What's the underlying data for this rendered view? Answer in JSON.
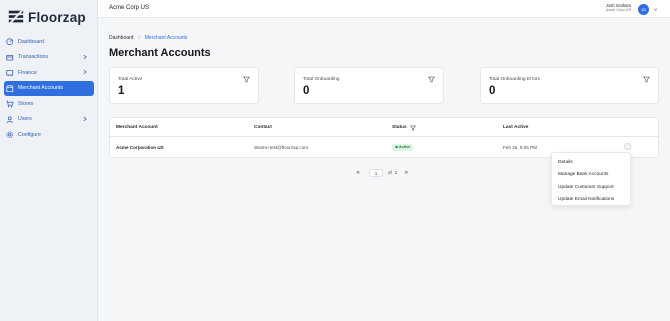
{
  "app": {
    "name": "Floorzap"
  },
  "sidebar": {
    "items": [
      {
        "label": "Dashboard",
        "icon": "dashboard-icon",
        "has_chevron": false,
        "active": false
      },
      {
        "label": "Transactions",
        "icon": "transactions-icon",
        "has_chevron": true,
        "active": false
      },
      {
        "label": "Finance",
        "icon": "finance-icon",
        "has_chevron": true,
        "active": false
      },
      {
        "label": "Merchant Accounts",
        "icon": "merchant-icon",
        "has_chevron": false,
        "active": true
      },
      {
        "label": "Stores",
        "icon": "cart-icon",
        "has_chevron": false,
        "active": false
      },
      {
        "label": "Users",
        "icon": "user-icon",
        "has_chevron": true,
        "active": false
      },
      {
        "label": "Configure",
        "icon": "gear-icon",
        "has_chevron": false,
        "active": false
      }
    ]
  },
  "header": {
    "org_title": "Acme Corp US",
    "user_name": "Josh Graham",
    "user_org": "Acme Corp US",
    "avatar_initials": "JG"
  },
  "breadcrumb": {
    "home": "Dashboard",
    "separator": "/",
    "current": "Merchant Accounts"
  },
  "page": {
    "title": "Merchant Accounts"
  },
  "stats": [
    {
      "label": "Total Active",
      "value": "1"
    },
    {
      "label": "Total Onboarding",
      "value": "0"
    },
    {
      "label": "Total Onboarding Errors",
      "value": "0"
    }
  ],
  "table": {
    "columns": [
      "Merchant Account",
      "Contact",
      "Status",
      "Last Active"
    ],
    "rows": [
      {
        "merchant": "Acme Corporation US",
        "contact": "deatra+test@floorzap.com",
        "status": "Active",
        "last_active": "Feb 26, 5:05 PM"
      }
    ]
  },
  "pagination": {
    "current_page": "1",
    "of_label": "of",
    "total_pages": "1",
    "prev_symbol": "«",
    "next_symbol": "»"
  },
  "row_menu": {
    "items": [
      "Details",
      "Manage Bank Accounts",
      "Update Customer Support",
      "Update Email Notifications"
    ]
  },
  "colors": {
    "accent": "#2f6fe0",
    "active_badge_bg": "#dff3e3",
    "active_badge_text": "#1e7a34",
    "sidebar_bg": "#eef1f6"
  }
}
